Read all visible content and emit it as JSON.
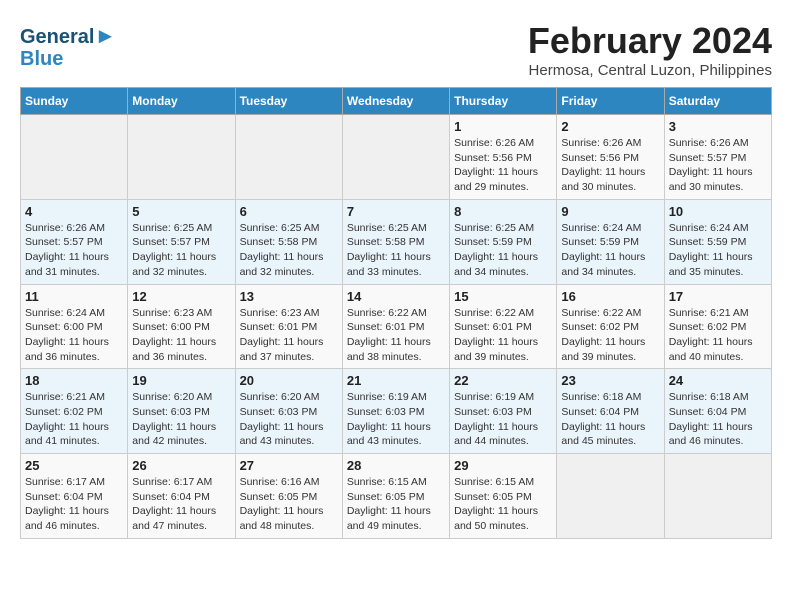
{
  "logo": {
    "line1": "General",
    "line2": "Blue"
  },
  "header": {
    "title": "February 2024",
    "subtitle": "Hermosa, Central Luzon, Philippines"
  },
  "weekdays": [
    "Sunday",
    "Monday",
    "Tuesday",
    "Wednesday",
    "Thursday",
    "Friday",
    "Saturday"
  ],
  "weeks": [
    [
      {
        "day": "",
        "info": ""
      },
      {
        "day": "",
        "info": ""
      },
      {
        "day": "",
        "info": ""
      },
      {
        "day": "",
        "info": ""
      },
      {
        "day": "1",
        "info": "Sunrise: 6:26 AM\nSunset: 5:56 PM\nDaylight: 11 hours\nand 29 minutes."
      },
      {
        "day": "2",
        "info": "Sunrise: 6:26 AM\nSunset: 5:56 PM\nDaylight: 11 hours\nand 30 minutes."
      },
      {
        "day": "3",
        "info": "Sunrise: 6:26 AM\nSunset: 5:57 PM\nDaylight: 11 hours\nand 30 minutes."
      }
    ],
    [
      {
        "day": "4",
        "info": "Sunrise: 6:26 AM\nSunset: 5:57 PM\nDaylight: 11 hours\nand 31 minutes."
      },
      {
        "day": "5",
        "info": "Sunrise: 6:25 AM\nSunset: 5:57 PM\nDaylight: 11 hours\nand 32 minutes."
      },
      {
        "day": "6",
        "info": "Sunrise: 6:25 AM\nSunset: 5:58 PM\nDaylight: 11 hours\nand 32 minutes."
      },
      {
        "day": "7",
        "info": "Sunrise: 6:25 AM\nSunset: 5:58 PM\nDaylight: 11 hours\nand 33 minutes."
      },
      {
        "day": "8",
        "info": "Sunrise: 6:25 AM\nSunset: 5:59 PM\nDaylight: 11 hours\nand 34 minutes."
      },
      {
        "day": "9",
        "info": "Sunrise: 6:24 AM\nSunset: 5:59 PM\nDaylight: 11 hours\nand 34 minutes."
      },
      {
        "day": "10",
        "info": "Sunrise: 6:24 AM\nSunset: 5:59 PM\nDaylight: 11 hours\nand 35 minutes."
      }
    ],
    [
      {
        "day": "11",
        "info": "Sunrise: 6:24 AM\nSunset: 6:00 PM\nDaylight: 11 hours\nand 36 minutes."
      },
      {
        "day": "12",
        "info": "Sunrise: 6:23 AM\nSunset: 6:00 PM\nDaylight: 11 hours\nand 36 minutes."
      },
      {
        "day": "13",
        "info": "Sunrise: 6:23 AM\nSunset: 6:01 PM\nDaylight: 11 hours\nand 37 minutes."
      },
      {
        "day": "14",
        "info": "Sunrise: 6:22 AM\nSunset: 6:01 PM\nDaylight: 11 hours\nand 38 minutes."
      },
      {
        "day": "15",
        "info": "Sunrise: 6:22 AM\nSunset: 6:01 PM\nDaylight: 11 hours\nand 39 minutes."
      },
      {
        "day": "16",
        "info": "Sunrise: 6:22 AM\nSunset: 6:02 PM\nDaylight: 11 hours\nand 39 minutes."
      },
      {
        "day": "17",
        "info": "Sunrise: 6:21 AM\nSunset: 6:02 PM\nDaylight: 11 hours\nand 40 minutes."
      }
    ],
    [
      {
        "day": "18",
        "info": "Sunrise: 6:21 AM\nSunset: 6:02 PM\nDaylight: 11 hours\nand 41 minutes."
      },
      {
        "day": "19",
        "info": "Sunrise: 6:20 AM\nSunset: 6:03 PM\nDaylight: 11 hours\nand 42 minutes."
      },
      {
        "day": "20",
        "info": "Sunrise: 6:20 AM\nSunset: 6:03 PM\nDaylight: 11 hours\nand 43 minutes."
      },
      {
        "day": "21",
        "info": "Sunrise: 6:19 AM\nSunset: 6:03 PM\nDaylight: 11 hours\nand 43 minutes."
      },
      {
        "day": "22",
        "info": "Sunrise: 6:19 AM\nSunset: 6:03 PM\nDaylight: 11 hours\nand 44 minutes."
      },
      {
        "day": "23",
        "info": "Sunrise: 6:18 AM\nSunset: 6:04 PM\nDaylight: 11 hours\nand 45 minutes."
      },
      {
        "day": "24",
        "info": "Sunrise: 6:18 AM\nSunset: 6:04 PM\nDaylight: 11 hours\nand 46 minutes."
      }
    ],
    [
      {
        "day": "25",
        "info": "Sunrise: 6:17 AM\nSunset: 6:04 PM\nDaylight: 11 hours\nand 46 minutes."
      },
      {
        "day": "26",
        "info": "Sunrise: 6:17 AM\nSunset: 6:04 PM\nDaylight: 11 hours\nand 47 minutes."
      },
      {
        "day": "27",
        "info": "Sunrise: 6:16 AM\nSunset: 6:05 PM\nDaylight: 11 hours\nand 48 minutes."
      },
      {
        "day": "28",
        "info": "Sunrise: 6:15 AM\nSunset: 6:05 PM\nDaylight: 11 hours\nand 49 minutes."
      },
      {
        "day": "29",
        "info": "Sunrise: 6:15 AM\nSunset: 6:05 PM\nDaylight: 11 hours\nand 50 minutes."
      },
      {
        "day": "",
        "info": ""
      },
      {
        "day": "",
        "info": ""
      }
    ]
  ]
}
